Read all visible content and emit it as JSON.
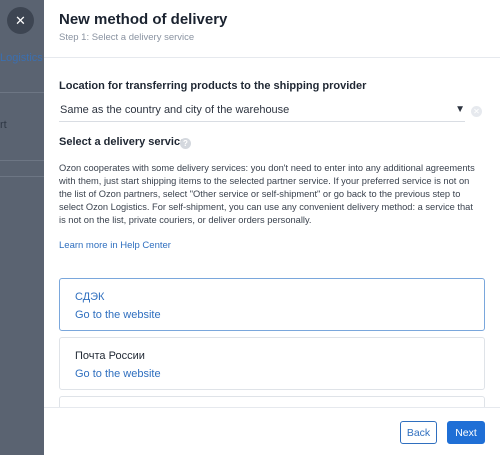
{
  "background": {
    "side_text_1": "Logistics",
    "side_text_2": "rt"
  },
  "close_button": {
    "icon": "close-icon",
    "glyph": "✕"
  },
  "modal": {
    "title": "New method of delivery",
    "subtitle": "Step 1: Select a delivery service"
  },
  "location": {
    "label": "Location for transferring products to the shipping provider",
    "selected_value": "Same as the country and city of the warehouse"
  },
  "service": {
    "label": "Select a delivery service",
    "description": "Ozon cooperates with some delivery services: you don't need to enter into any additional agreements with them, just start shipping items to the selected partner service. If your preferred service is not on the list of Ozon partners, select \"Other service or self-shipment\" or go back to the previous step to select Ozon Logistics. For self-shipment, you can use any convenient delivery method: a service that is not on the list, private couriers, or deliver orders personally.",
    "learn_more": "Learn more in Help Center"
  },
  "cards": [
    {
      "name": "СДЭК",
      "link": "Go to the website",
      "selected": true
    },
    {
      "name": "Почта России",
      "link": "Go to the website",
      "selected": false
    }
  ],
  "footer": {
    "back_label": "Back",
    "next_label": "Next"
  },
  "colors": {
    "accent": "#1f6fd6",
    "link": "#2f6fbf",
    "overlay": "#5e6775"
  }
}
